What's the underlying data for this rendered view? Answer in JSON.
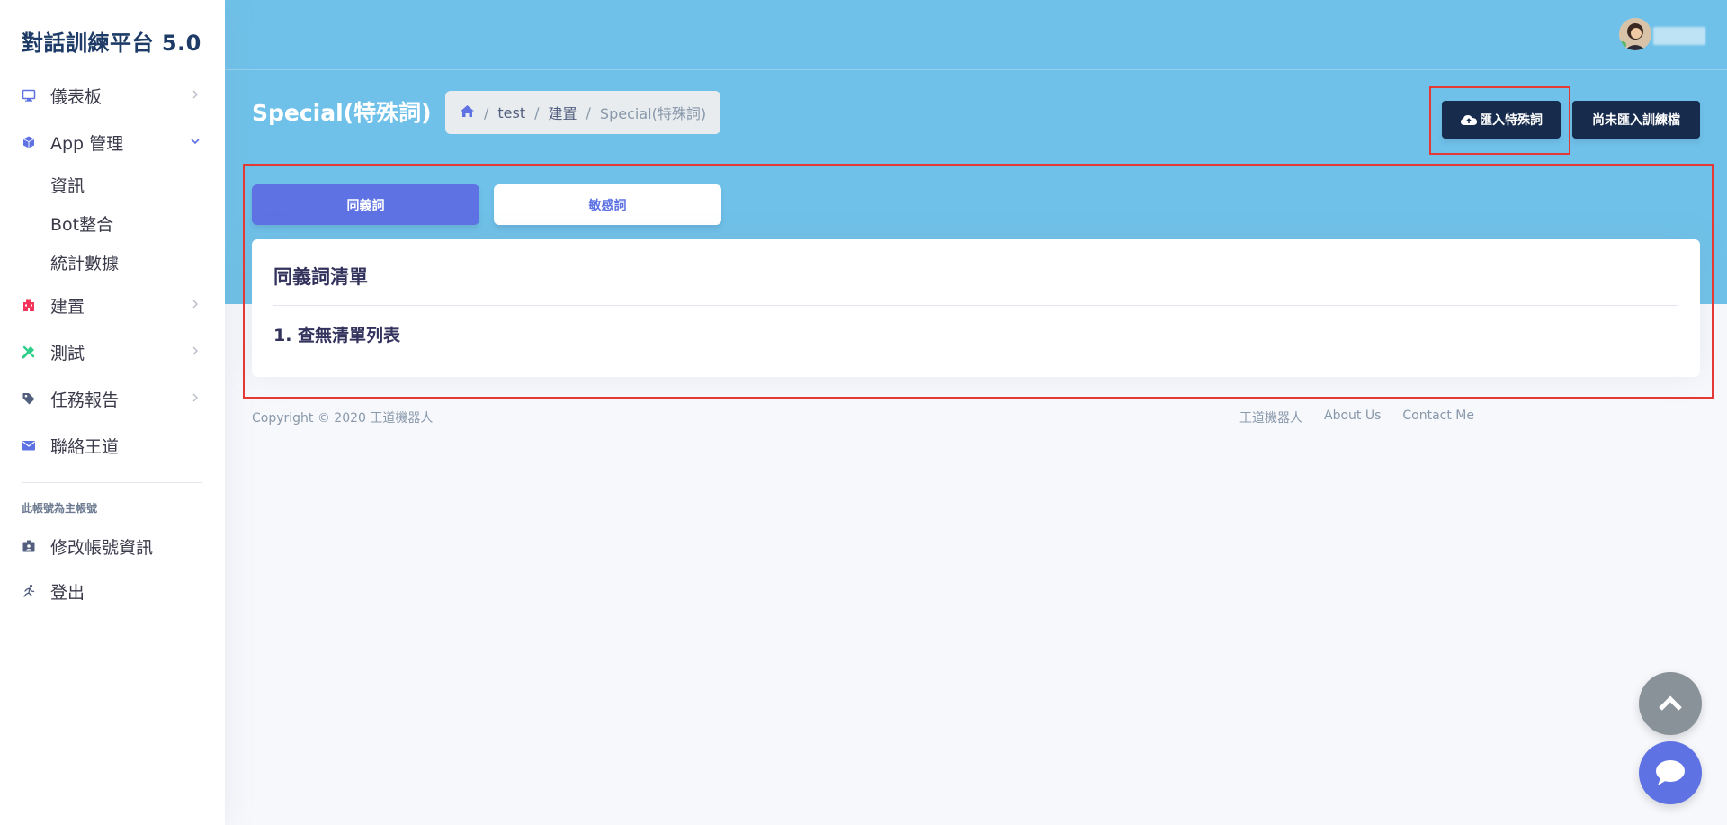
{
  "sidebar": {
    "brand": "對話訓練平台 5.0",
    "items": [
      {
        "label": "儀表板",
        "icon": "monitor-icon"
      },
      {
        "label": "App 管理",
        "icon": "cube-icon"
      },
      {
        "label": "建置",
        "icon": "building-icon"
      },
      {
        "label": "測試",
        "icon": "tools-icon"
      },
      {
        "label": "任務報告",
        "icon": "tag-icon"
      },
      {
        "label": "聯絡王道",
        "icon": "envelope-icon"
      }
    ],
    "sub_items": [
      {
        "label": "資訊"
      },
      {
        "label": "Bot整合"
      },
      {
        "label": "統計數據"
      }
    ],
    "account_note": "此帳號為主帳號",
    "account_items": [
      {
        "label": "修改帳號資訊",
        "icon": "id-badge-icon"
      },
      {
        "label": "登出",
        "icon": "running-icon"
      }
    ]
  },
  "header": {
    "page_title": "Special(特殊詞)",
    "breadcrumb": [
      "test",
      "建置",
      "Special(特殊詞)"
    ],
    "import_button": "匯入特殊詞",
    "unimported_button": "尚未匯入訓練檔"
  },
  "tabs": [
    {
      "label": "同義詞",
      "active": true
    },
    {
      "label": "敏感詞",
      "active": false
    }
  ],
  "card": {
    "title": "同義詞清單",
    "empty_message": "1. 查無清單列表"
  },
  "footer": {
    "copyright": "Copyright © 2020 王道機器人",
    "links": [
      "王道機器人",
      "About Us",
      "Contact Me"
    ]
  },
  "colors": {
    "header_bg": "#6fc1e9",
    "primary": "#5e72e4",
    "dark_button": "#172b4d",
    "highlight": "#e53935"
  }
}
